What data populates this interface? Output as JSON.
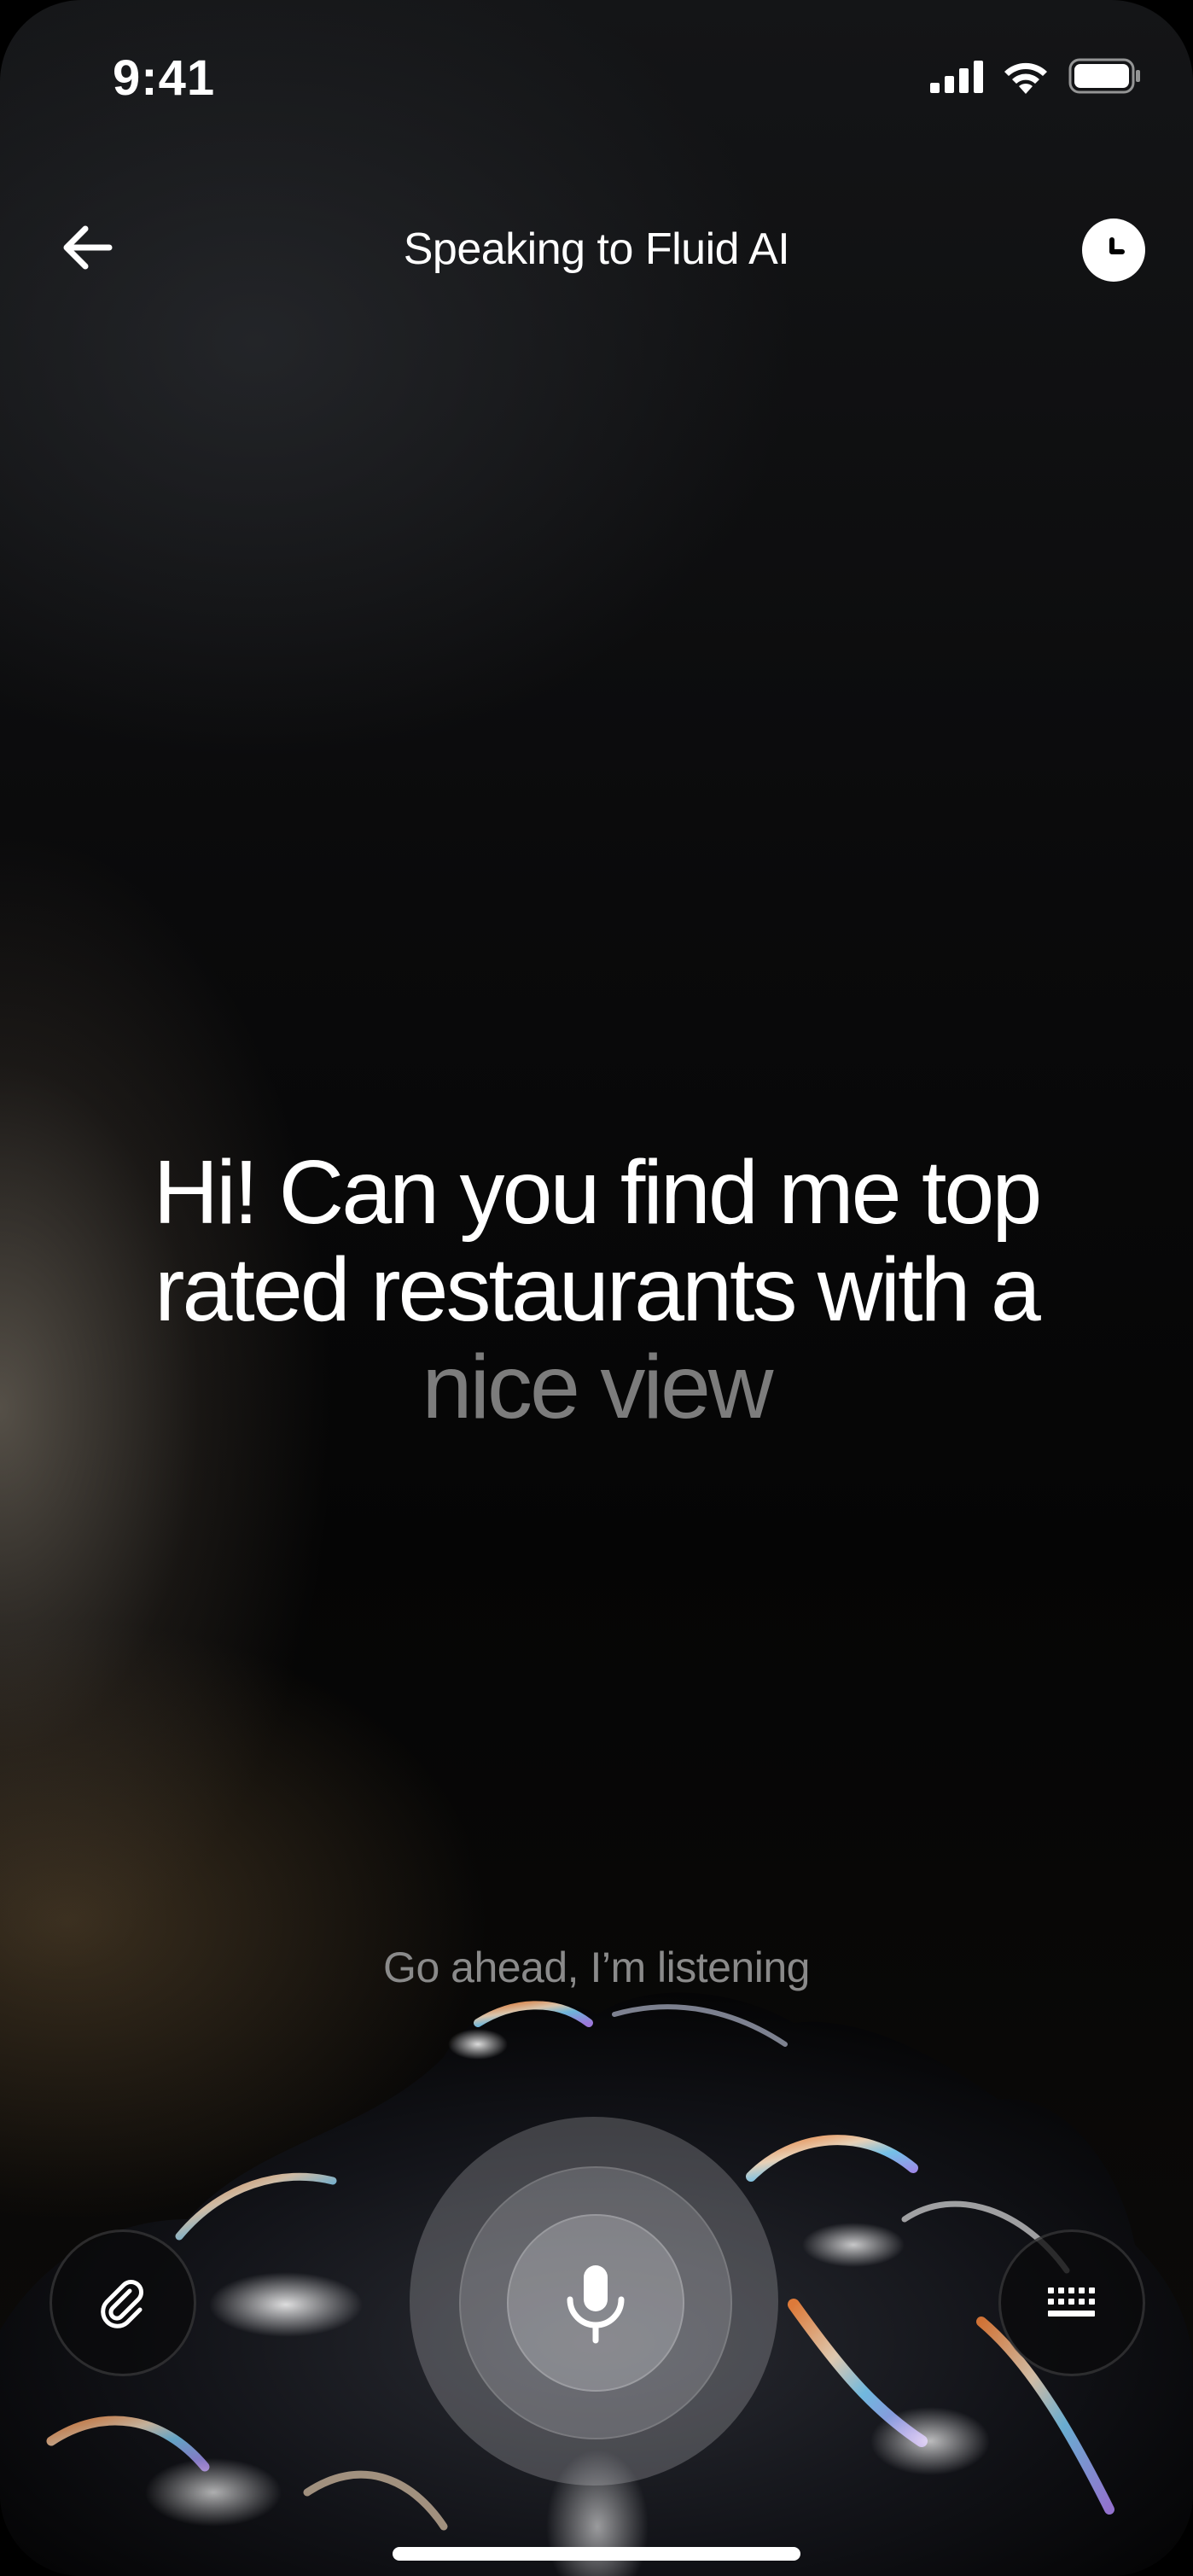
{
  "status_bar": {
    "time": "9:41",
    "icons": [
      "cellular-signal-icon",
      "wifi-icon",
      "battery-icon"
    ]
  },
  "header": {
    "back_icon": "arrow-left-icon",
    "title": "Speaking to Fluid AI",
    "history_icon": "clock-icon"
  },
  "transcript": {
    "line1": "Hi! Can you find me top",
    "line2": "rated restaurants with a",
    "pending": "nice view"
  },
  "listening_hint": "Go ahead, I’m listening",
  "controls": {
    "attach_icon": "paperclip-icon",
    "mic_icon": "microphone-icon",
    "keyboard_icon": "keyboard-icon"
  },
  "colors": {
    "background": "#000000",
    "text": "#ffffff",
    "pending_text": "#7c7c7c",
    "hint_text": "#8a8a8a"
  }
}
